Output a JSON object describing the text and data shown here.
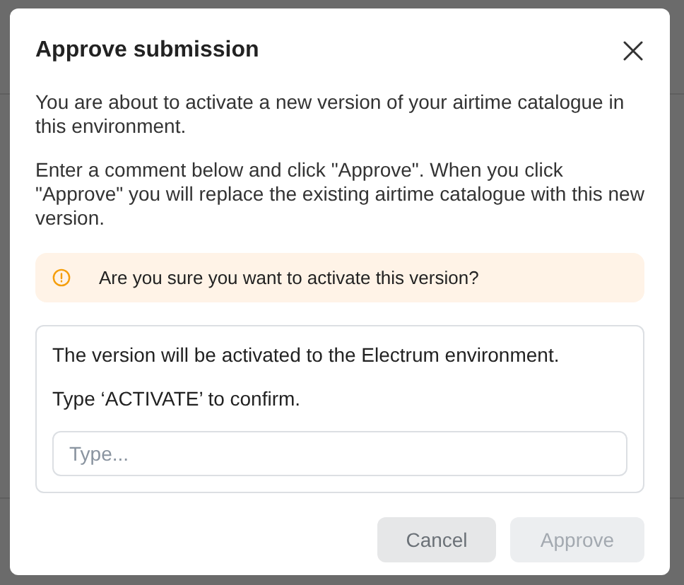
{
  "dialog": {
    "title": "Approve submission",
    "paragraphs": [
      "You are about to activate a new version of your airtime catalogue in this environment.",
      "Enter a comment below and click \"Approve\". When you click \"Approve\" you will replace the existing airtime catalogue with this new version."
    ],
    "alert": {
      "text": "Are you sure you want to activate this version?"
    },
    "confirm": {
      "lines": [
        "The version will be activated to the Electrum environment.",
        "Type ‘ACTIVATE’ to confirm."
      ],
      "field": {
        "placeholder": "Type..."
      }
    },
    "buttons": [
      {
        "label": "Cancel",
        "kind": "secondary",
        "disabled": false
      },
      {
        "label": "Approve",
        "kind": "primary",
        "disabled": true
      }
    ]
  }
}
